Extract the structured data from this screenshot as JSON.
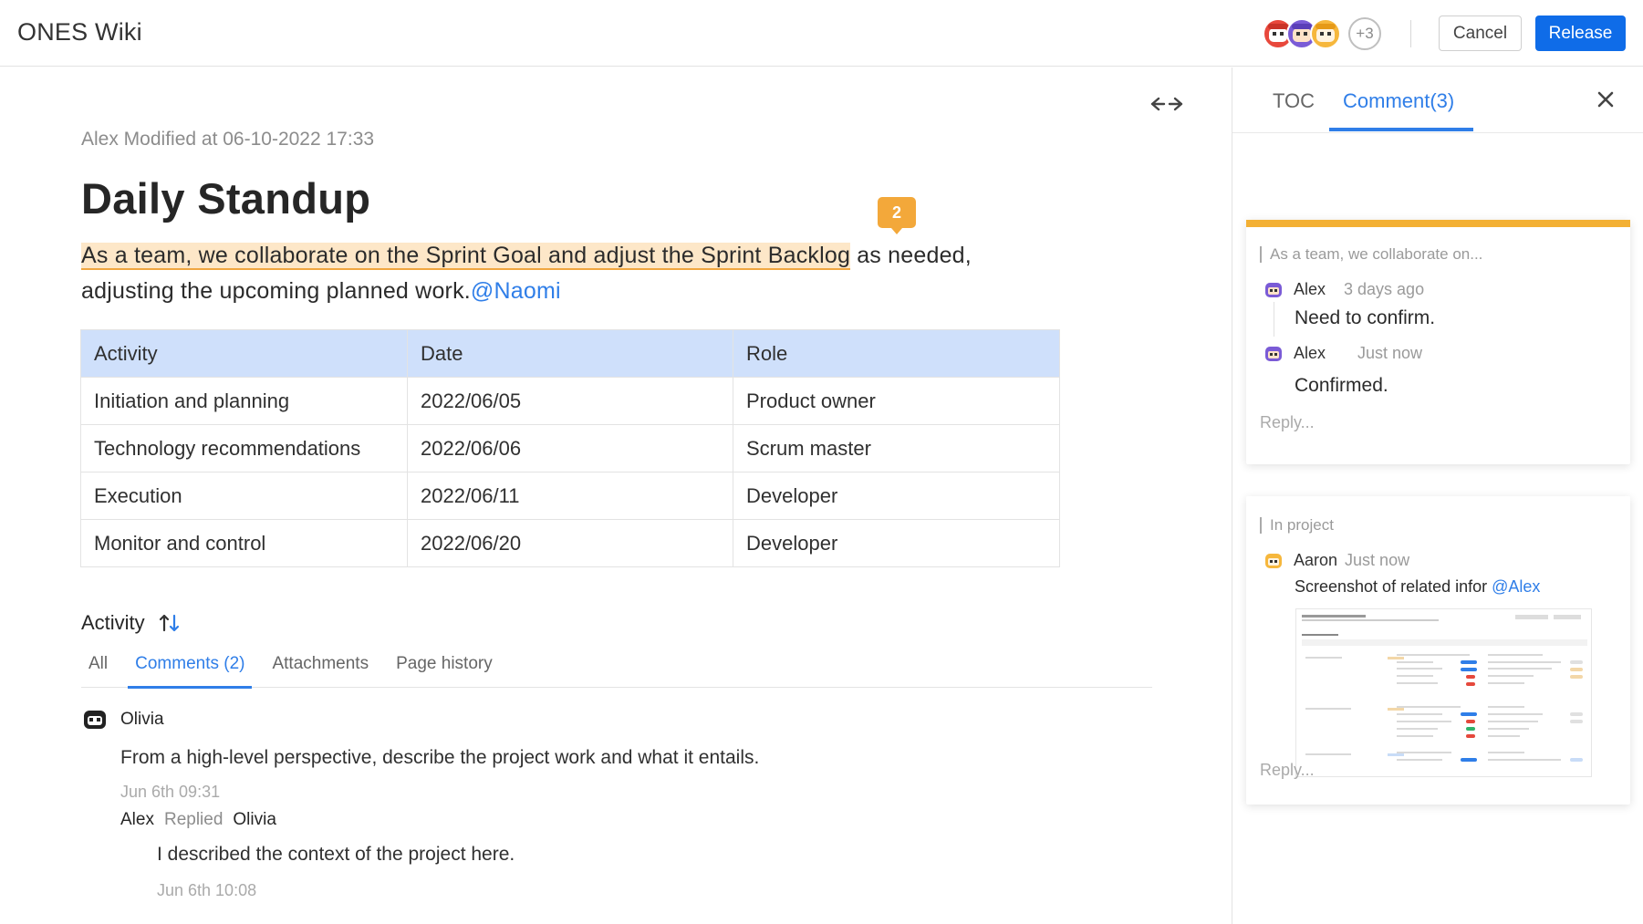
{
  "app": {
    "title": "ONES Wiki"
  },
  "header": {
    "more_collaborators": "+3",
    "cancel_label": "Cancel",
    "release_label": "Release"
  },
  "doc": {
    "meta": "Alex Modified at 06-10-2022 17:33",
    "title": "Daily Standup",
    "comment_badge": "2",
    "highlight_text": "As a team, we collaborate on the Sprint Goal and adjust the Sprint Backlog",
    "para_line1_rest": " as needed,",
    "para_line2": "adjusting the upcoming planned work.",
    "mention": "@Naomi",
    "table": {
      "headers": [
        "Activity",
        "Date",
        "Role"
      ],
      "rows": [
        [
          "Initiation and planning",
          "2022/06/05",
          "Product owner"
        ],
        [
          "Technology recommendations",
          "2022/06/06",
          "Scrum master"
        ],
        [
          "Execution",
          "2022/06/11",
          "Developer"
        ],
        [
          "Monitor and control",
          "2022/06/20",
          "Developer"
        ]
      ]
    }
  },
  "activity": {
    "heading": "Activity",
    "tabs": [
      "All",
      "Comments (2)",
      "Attachments",
      "Page history"
    ],
    "active_tab": "Comments (2)",
    "comment": {
      "author": "Olivia",
      "text": "From a high-level perspective, describe the project work and what it entails.",
      "time": "Jun 6th 09:31"
    },
    "reply": {
      "author": "Alex",
      "verb": "Replied",
      "target": "Olivia",
      "text": "I described the context of the project here.",
      "time": "Jun 6th 10:08"
    }
  },
  "panel": {
    "tabs": [
      "TOC",
      "Comment(3)"
    ],
    "active_tab": "Comment(3)",
    "cards": [
      {
        "quote": "As a team, we collaborate on...",
        "comments": [
          {
            "author": "Alex",
            "time": "3 days ago",
            "text": "Need to confirm."
          },
          {
            "author": "Alex",
            "time": "Just now",
            "text": "Confirmed."
          }
        ],
        "reply_placeholder": "Reply..."
      },
      {
        "quote": "In project",
        "comments": [
          {
            "author": "Aaron",
            "time": "Just now",
            "text": "Screenshot of related infor ",
            "mention": "@Alex"
          }
        ],
        "reply_placeholder": "Reply..."
      }
    ]
  },
  "colors": {
    "accent": "#0f6ce8",
    "link": "#2f7ee8",
    "highlight": "#fde7c8",
    "badge": "#f3a83a",
    "table_header": "#cfe0fb"
  },
  "icons": [
    "expand-width-icon",
    "sort-icon",
    "close-icon",
    "avatar-icon"
  ]
}
